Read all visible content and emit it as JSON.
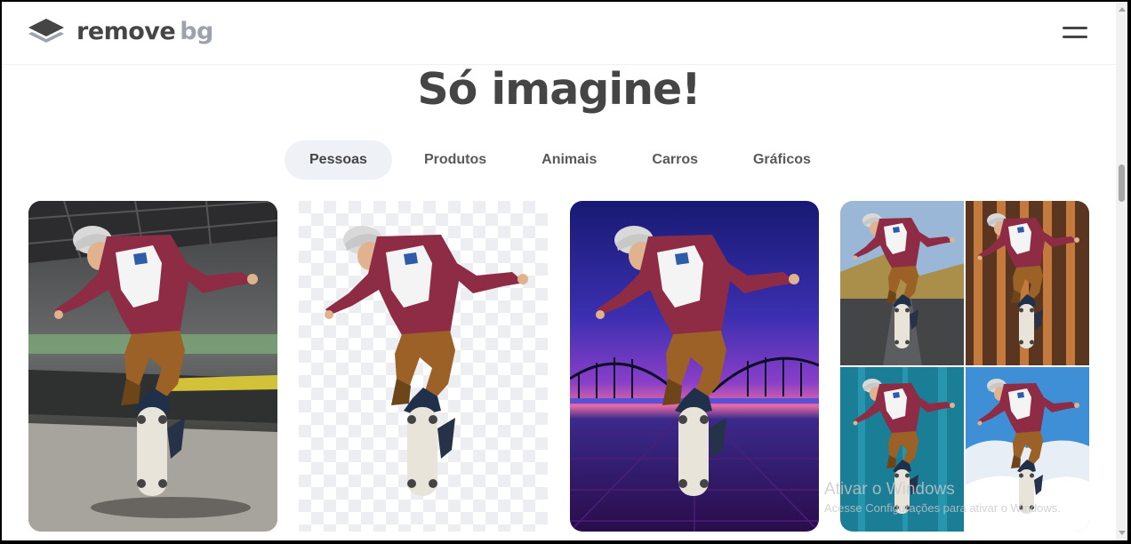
{
  "header": {
    "logo": {
      "part1": "remove",
      "part2": "bg",
      "icon": "layers-logo-icon"
    },
    "menu_icon": "hamburger-menu-icon"
  },
  "main": {
    "title": "Só imagine!",
    "tabs": [
      {
        "label": "Pessoas",
        "active": true
      },
      {
        "label": "Produtos",
        "active": false
      },
      {
        "label": "Animais",
        "active": false
      },
      {
        "label": "Carros",
        "active": false
      },
      {
        "label": "Gráficos",
        "active": false
      }
    ],
    "cards": [
      {
        "name": "original-photo"
      },
      {
        "name": "background-removed"
      },
      {
        "name": "new-background-sunset"
      },
      {
        "name": "background-collage"
      }
    ]
  },
  "watermark": {
    "line1": "Ativar o Windows",
    "line2": "Acesse Configurações para ativar o Windows."
  },
  "colors": {
    "text_dark": "#454545",
    "logo_gray": "#9ca3ab",
    "tab_active_bg": "#eef1f5"
  }
}
